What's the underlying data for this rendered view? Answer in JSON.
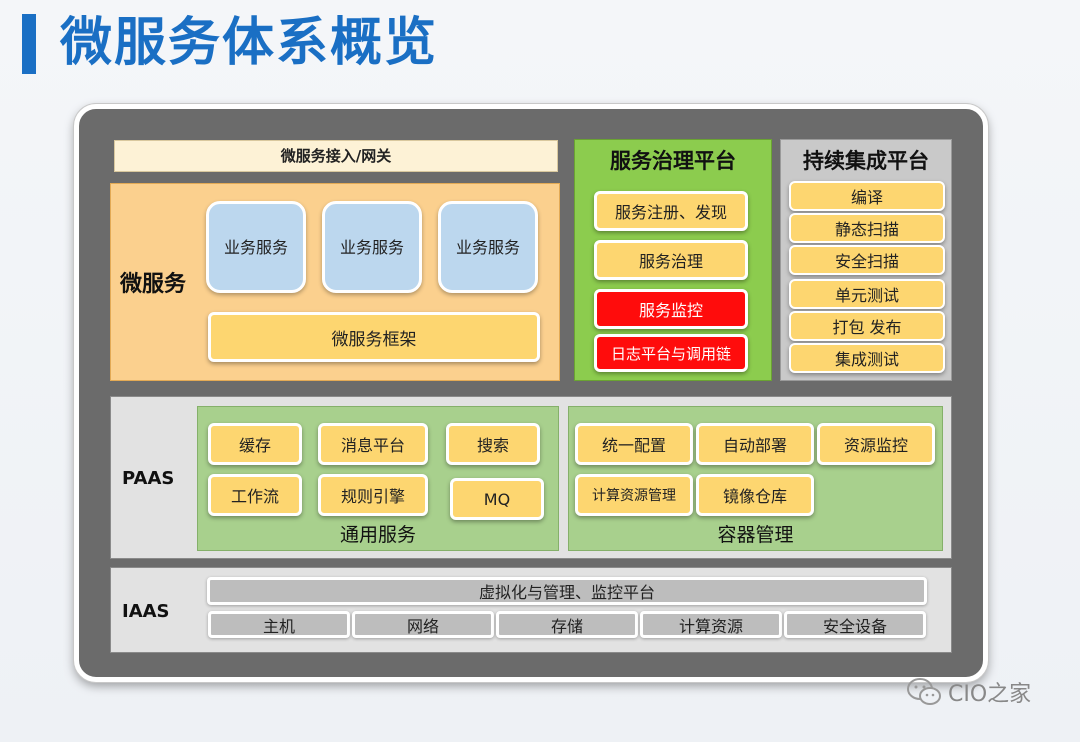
{
  "title": "微服务体系概览",
  "top_row": {
    "gateway": "微服务接入/网关",
    "microservice": {
      "label": "微服务",
      "business": [
        "业务服务",
        "业务服务",
        "业务服务"
      ],
      "framework": "微服务框架"
    },
    "governance": {
      "title": "服务治理平台",
      "items": [
        "服务注册、发现",
        "服务治理",
        "服务监控",
        "日志平台与调用链"
      ]
    },
    "ci": {
      "title": "持续集成平台",
      "items": [
        "编译",
        "静态扫描",
        "安全扫描",
        "单元测试",
        "打包 发布",
        "集成测试"
      ]
    }
  },
  "paas": {
    "label": "PAAS",
    "general": {
      "label": "通用服务",
      "items": [
        "缓存",
        "消息平台",
        "搜索",
        "工作流",
        "规则引擎",
        "MQ"
      ]
    },
    "container": {
      "label": "容器管理",
      "items": [
        "统一配置",
        "自动部署",
        "资源监控",
        "计算资源管理",
        "镜像仓库"
      ]
    }
  },
  "iaas": {
    "label": "IAAS",
    "platform": "虚拟化与管理、监控平台",
    "items": [
      "主机",
      "网络",
      "存储",
      "计算资源",
      "安全设备"
    ]
  },
  "watermark": "CIO之家",
  "colors": {
    "title_blue": "#1a6fc4",
    "frame_gray": "#6b6b6b",
    "orange_panel": "#fbd08e",
    "green_panel": "#8ccc4e",
    "green_group": "#a8d08d",
    "yellow_button": "#fdd670",
    "alert_red": "#ff0c0c",
    "business_blue": "#bcd7ee"
  }
}
